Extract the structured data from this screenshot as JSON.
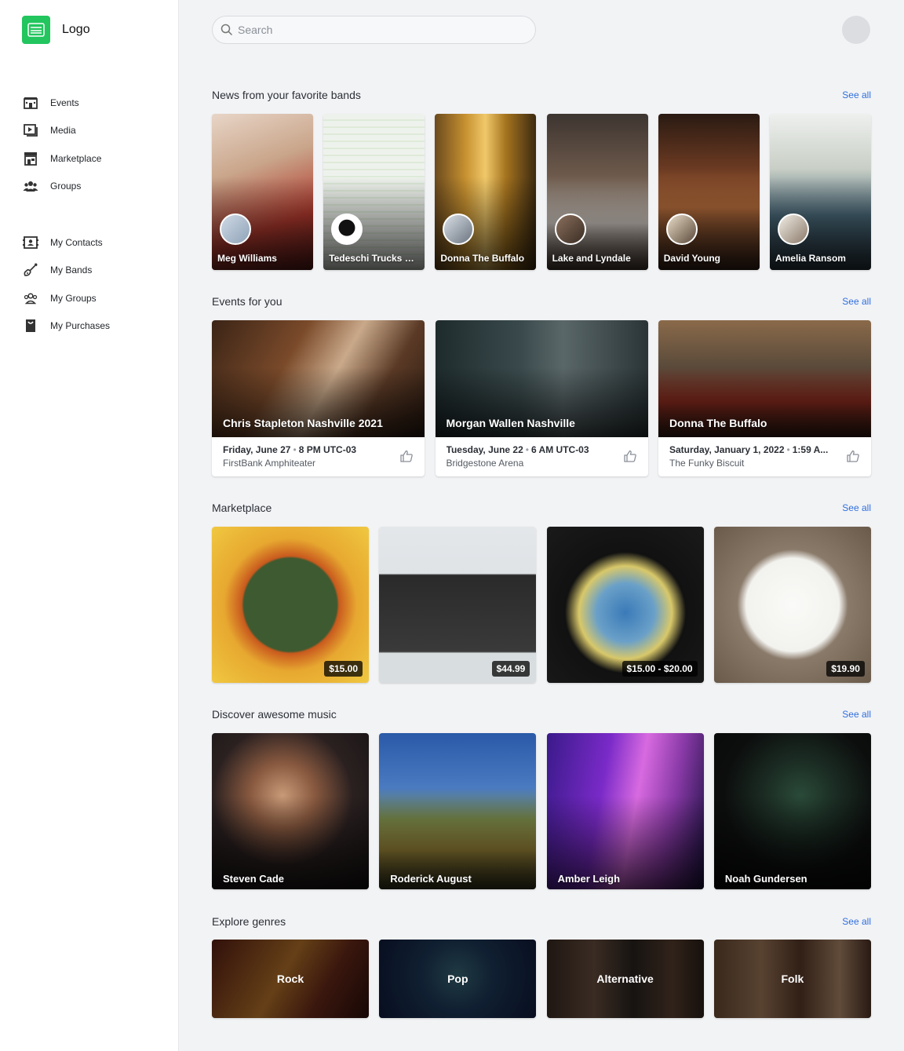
{
  "brand": {
    "name": "Logo"
  },
  "sidebar": {
    "main": [
      {
        "label": "Events",
        "icon": "events-icon"
      },
      {
        "label": "Media",
        "icon": "media-icon"
      },
      {
        "label": "Marketplace",
        "icon": "store-icon"
      },
      {
        "label": "Groups",
        "icon": "groups-icon"
      }
    ],
    "mine": [
      {
        "label": "My Contacts",
        "icon": "contacts-icon"
      },
      {
        "label": "My Bands",
        "icon": "guitar-icon"
      },
      {
        "label": "My Groups",
        "icon": "groups-icon"
      },
      {
        "label": "My Purchases",
        "icon": "purchases-icon"
      }
    ]
  },
  "search": {
    "placeholder": "Search"
  },
  "sections": {
    "news": {
      "title": "News from your favorite bands",
      "see_all": "See all",
      "items": [
        {
          "name": "Meg Williams"
        },
        {
          "name": "Tedeschi Trucks B..."
        },
        {
          "name": "Donna The Buffalo"
        },
        {
          "name": "Lake and Lyndale"
        },
        {
          "name": "David Young"
        },
        {
          "name": "Amelia Ransom"
        }
      ]
    },
    "events": {
      "title": "Events for you",
      "see_all": "See all",
      "items": [
        {
          "title": "Chris Stapleton Nashville 2021",
          "day": "Friday, June 27",
          "time": "8 PM UTC-03",
          "venue": "FirstBank Amphiteater"
        },
        {
          "title": "Morgan Wallen Nashville",
          "day": "Tuesday, June 22",
          "time": "6 AM UTC-03",
          "venue": "Bridgestone Arena"
        },
        {
          "title": "Donna The Buffalo",
          "day": "Saturday, January 1, 2022",
          "time": "1:59 A...",
          "venue": "The Funky Biscuit"
        }
      ]
    },
    "marketplace": {
      "title": "Marketplace",
      "see_all": "See all",
      "items": [
        {
          "price": "$15.00"
        },
        {
          "price": "$44.99"
        },
        {
          "price": "$15.00 - $20.00"
        },
        {
          "price": "$19.90"
        }
      ]
    },
    "discover": {
      "title": "Discover awesome music",
      "see_all": "See all",
      "items": [
        {
          "name": "Steven Cade"
        },
        {
          "name": "Roderick August"
        },
        {
          "name": "Amber Leigh"
        },
        {
          "name": "Noah Gundersen"
        }
      ]
    },
    "genres": {
      "title": "Explore genres",
      "see_all": "See all",
      "items": [
        {
          "name": "Rock"
        },
        {
          "name": "Pop"
        },
        {
          "name": "Alternative"
        },
        {
          "name": "Folk"
        }
      ]
    }
  },
  "colors": {
    "accent": "#2f6fdf",
    "brand": "#22c55e",
    "background": "#f2f3f5"
  }
}
